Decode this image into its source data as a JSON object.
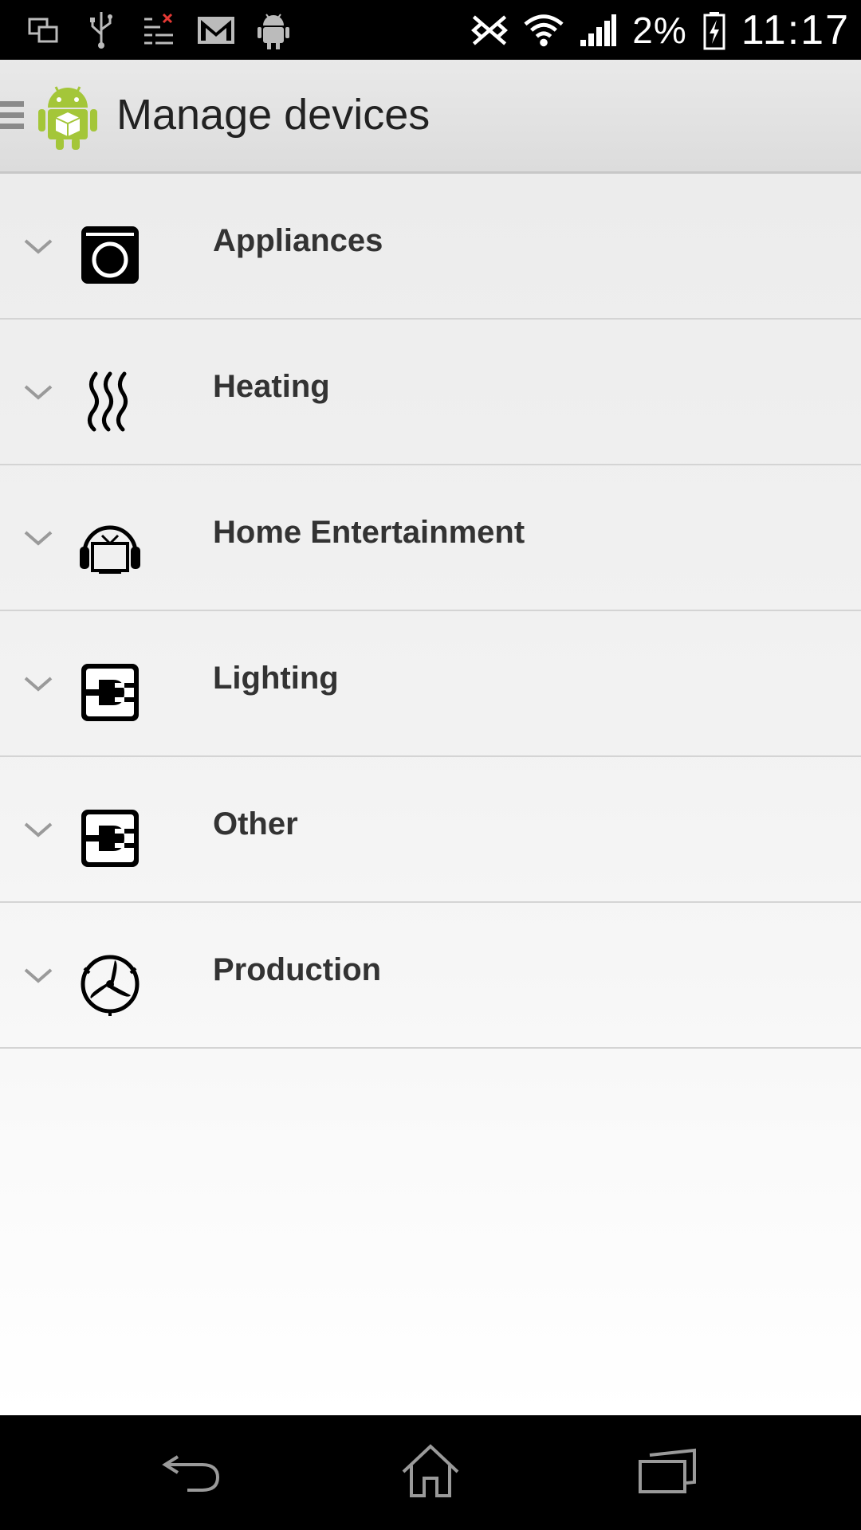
{
  "status_bar": {
    "left_icons": [
      "screen-mirror-icon",
      "usb-icon",
      "sim-error-icon",
      "gmail-icon",
      "android-debug-icon"
    ],
    "right_icons": [
      "vibrate-off-icon",
      "wifi-icon",
      "signal-icon"
    ],
    "battery_percent": "2%",
    "battery_icon": "battery-charging-icon",
    "time": "11:17"
  },
  "action_bar": {
    "title": "Manage devices",
    "app_icon": "android-app-icon",
    "drawer_icon": "drawer-menu-icon"
  },
  "categories": [
    {
      "label": "Appliances",
      "icon": "washing-machine-icon"
    },
    {
      "label": "Heating",
      "icon": "heat-waves-icon"
    },
    {
      "label": "Home Entertainment",
      "icon": "tv-icon"
    },
    {
      "label": "Lighting",
      "icon": "plug-icon"
    },
    {
      "label": "Other",
      "icon": "plug-icon"
    },
    {
      "label": "Production",
      "icon": "wind-turbine-icon"
    }
  ],
  "nav_bar": {
    "buttons": [
      "back-icon",
      "home-icon",
      "recent-apps-icon"
    ]
  },
  "colors": {
    "accent_android_green": "#a4c639",
    "list_text": "#333333"
  }
}
